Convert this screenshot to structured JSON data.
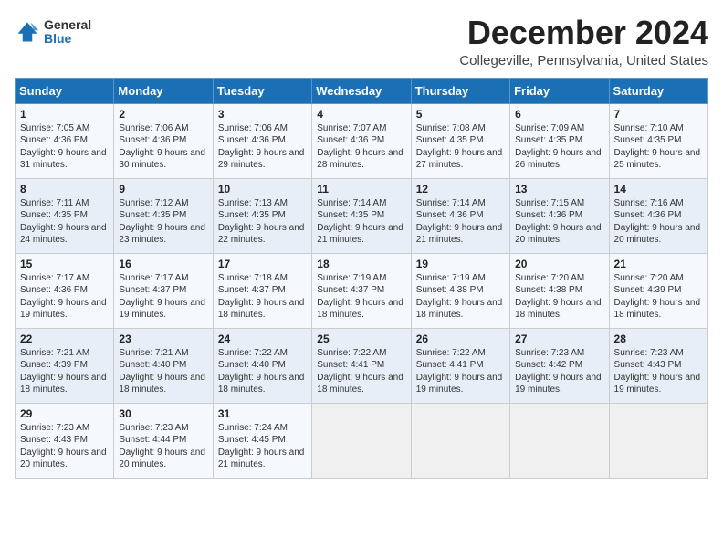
{
  "header": {
    "logo_general": "General",
    "logo_blue": "Blue",
    "title": "December 2024",
    "subtitle": "Collegeville, Pennsylvania, United States"
  },
  "days_of_week": [
    "Sunday",
    "Monday",
    "Tuesday",
    "Wednesday",
    "Thursday",
    "Friday",
    "Saturday"
  ],
  "weeks": [
    [
      {
        "day": 1,
        "sunrise": "7:05 AM",
        "sunset": "4:36 PM",
        "daylight": "9 hours and 31 minutes."
      },
      {
        "day": 2,
        "sunrise": "7:06 AM",
        "sunset": "4:36 PM",
        "daylight": "9 hours and 30 minutes."
      },
      {
        "day": 3,
        "sunrise": "7:06 AM",
        "sunset": "4:36 PM",
        "daylight": "9 hours and 29 minutes."
      },
      {
        "day": 4,
        "sunrise": "7:07 AM",
        "sunset": "4:36 PM",
        "daylight": "9 hours and 28 minutes."
      },
      {
        "day": 5,
        "sunrise": "7:08 AM",
        "sunset": "4:35 PM",
        "daylight": "9 hours and 27 minutes."
      },
      {
        "day": 6,
        "sunrise": "7:09 AM",
        "sunset": "4:35 PM",
        "daylight": "9 hours and 26 minutes."
      },
      {
        "day": 7,
        "sunrise": "7:10 AM",
        "sunset": "4:35 PM",
        "daylight": "9 hours and 25 minutes."
      }
    ],
    [
      {
        "day": 8,
        "sunrise": "7:11 AM",
        "sunset": "4:35 PM",
        "daylight": "9 hours and 24 minutes."
      },
      {
        "day": 9,
        "sunrise": "7:12 AM",
        "sunset": "4:35 PM",
        "daylight": "9 hours and 23 minutes."
      },
      {
        "day": 10,
        "sunrise": "7:13 AM",
        "sunset": "4:35 PM",
        "daylight": "9 hours and 22 minutes."
      },
      {
        "day": 11,
        "sunrise": "7:14 AM",
        "sunset": "4:35 PM",
        "daylight": "9 hours and 21 minutes."
      },
      {
        "day": 12,
        "sunrise": "7:14 AM",
        "sunset": "4:36 PM",
        "daylight": "9 hours and 21 minutes."
      },
      {
        "day": 13,
        "sunrise": "7:15 AM",
        "sunset": "4:36 PM",
        "daylight": "9 hours and 20 minutes."
      },
      {
        "day": 14,
        "sunrise": "7:16 AM",
        "sunset": "4:36 PM",
        "daylight": "9 hours and 20 minutes."
      }
    ],
    [
      {
        "day": 15,
        "sunrise": "7:17 AM",
        "sunset": "4:36 PM",
        "daylight": "9 hours and 19 minutes."
      },
      {
        "day": 16,
        "sunrise": "7:17 AM",
        "sunset": "4:37 PM",
        "daylight": "9 hours and 19 minutes."
      },
      {
        "day": 17,
        "sunrise": "7:18 AM",
        "sunset": "4:37 PM",
        "daylight": "9 hours and 18 minutes."
      },
      {
        "day": 18,
        "sunrise": "7:19 AM",
        "sunset": "4:37 PM",
        "daylight": "9 hours and 18 minutes."
      },
      {
        "day": 19,
        "sunrise": "7:19 AM",
        "sunset": "4:38 PM",
        "daylight": "9 hours and 18 minutes."
      },
      {
        "day": 20,
        "sunrise": "7:20 AM",
        "sunset": "4:38 PM",
        "daylight": "9 hours and 18 minutes."
      },
      {
        "day": 21,
        "sunrise": "7:20 AM",
        "sunset": "4:39 PM",
        "daylight": "9 hours and 18 minutes."
      }
    ],
    [
      {
        "day": 22,
        "sunrise": "7:21 AM",
        "sunset": "4:39 PM",
        "daylight": "9 hours and 18 minutes."
      },
      {
        "day": 23,
        "sunrise": "7:21 AM",
        "sunset": "4:40 PM",
        "daylight": "9 hours and 18 minutes."
      },
      {
        "day": 24,
        "sunrise": "7:22 AM",
        "sunset": "4:40 PM",
        "daylight": "9 hours and 18 minutes."
      },
      {
        "day": 25,
        "sunrise": "7:22 AM",
        "sunset": "4:41 PM",
        "daylight": "9 hours and 18 minutes."
      },
      {
        "day": 26,
        "sunrise": "7:22 AM",
        "sunset": "4:41 PM",
        "daylight": "9 hours and 19 minutes."
      },
      {
        "day": 27,
        "sunrise": "7:23 AM",
        "sunset": "4:42 PM",
        "daylight": "9 hours and 19 minutes."
      },
      {
        "day": 28,
        "sunrise": "7:23 AM",
        "sunset": "4:43 PM",
        "daylight": "9 hours and 19 minutes."
      }
    ],
    [
      {
        "day": 29,
        "sunrise": "7:23 AM",
        "sunset": "4:43 PM",
        "daylight": "9 hours and 20 minutes."
      },
      {
        "day": 30,
        "sunrise": "7:23 AM",
        "sunset": "4:44 PM",
        "daylight": "9 hours and 20 minutes."
      },
      {
        "day": 31,
        "sunrise": "7:24 AM",
        "sunset": "4:45 PM",
        "daylight": "9 hours and 21 minutes."
      },
      null,
      null,
      null,
      null
    ]
  ]
}
